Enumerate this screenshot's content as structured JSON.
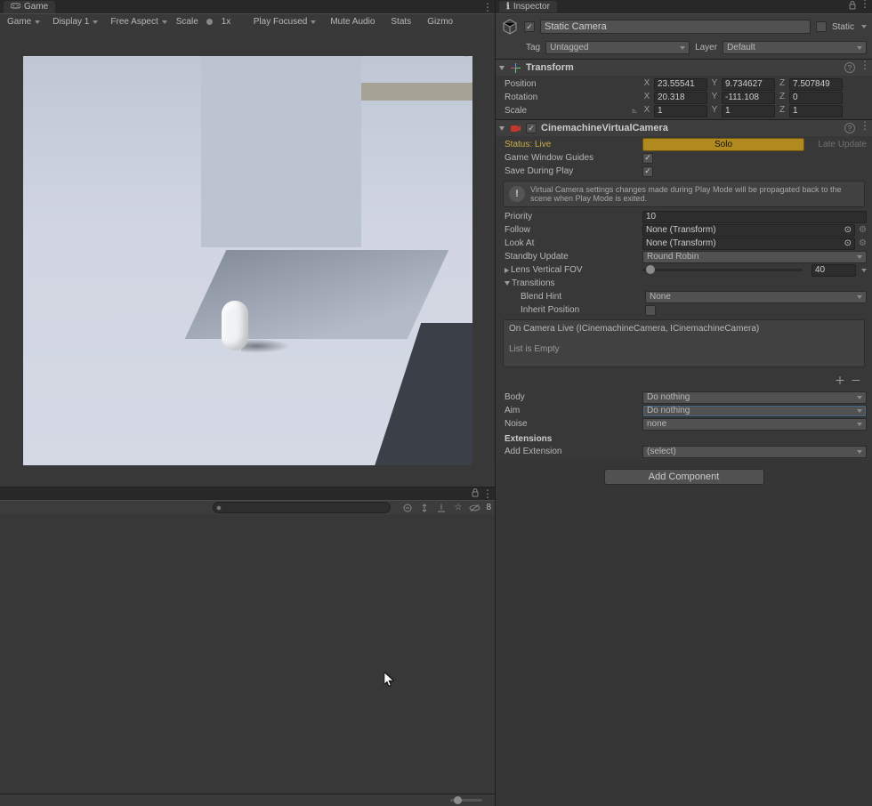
{
  "game_tab": {
    "label": "Game"
  },
  "game_toolbar": {
    "mode": "Game",
    "display": "Display 1",
    "aspect": "Free Aspect",
    "scale_label": "Scale",
    "scale_value": "1x",
    "play_mode": "Play Focused",
    "mute": "Mute Audio",
    "stats": "Stats",
    "gizmos": "Gizmo"
  },
  "console_toolbar": {
    "search_placeholder": "",
    "count": "8"
  },
  "inspector": {
    "tab": "Inspector",
    "enabled": true,
    "name": "Static Camera",
    "static_label": "Static",
    "static_checked": false,
    "tag_label": "Tag",
    "tag_value": "Untagged",
    "layer_label": "Layer",
    "layer_value": "Default"
  },
  "transform": {
    "title": "Transform",
    "position_label": "Position",
    "rotation_label": "Rotation",
    "scale_label": "Scale",
    "pos": {
      "x": "23.55541",
      "y": "9.734627",
      "z": "7.507849"
    },
    "rot": {
      "x": "20.318",
      "y": "-111.108",
      "z": "0"
    },
    "scl": {
      "x": "1",
      "y": "1",
      "z": "1"
    }
  },
  "vcam": {
    "title": "CinemachineVirtualCamera",
    "status_label": "Status: Live",
    "solo": "Solo",
    "late_update": "Late Update",
    "gwg_label": "Game Window Guides",
    "gwg": true,
    "sdp_label": "Save During Play",
    "sdp": true,
    "info": "Virtual Camera settings changes made during Play Mode will be propagated back to the scene when Play Mode is exited.",
    "priority_label": "Priority",
    "priority": "10",
    "follow_label": "Follow",
    "follow": "None (Transform)",
    "lookat_label": "Look At",
    "lookat": "None (Transform)",
    "standby_label": "Standby Update",
    "standby": "Round Robin",
    "fov_label": "Lens Vertical FOV",
    "fov": "40",
    "transitions_label": "Transitions",
    "blend_label": "Blend Hint",
    "blend": "None",
    "inherit_label": "Inherit Position",
    "inherit": false,
    "event_header": "On Camera Live (ICinemachineCamera, ICinemachineCamera)",
    "event_empty": "List is Empty",
    "body_label": "Body",
    "body": "Do nothing",
    "aim_label": "Aim",
    "aim": "Do nothing",
    "noise_label": "Noise",
    "noise": "none",
    "ext_label": "Extensions",
    "addext_label": "Add Extension",
    "addext": "(select)",
    "add_component": "Add Component"
  }
}
